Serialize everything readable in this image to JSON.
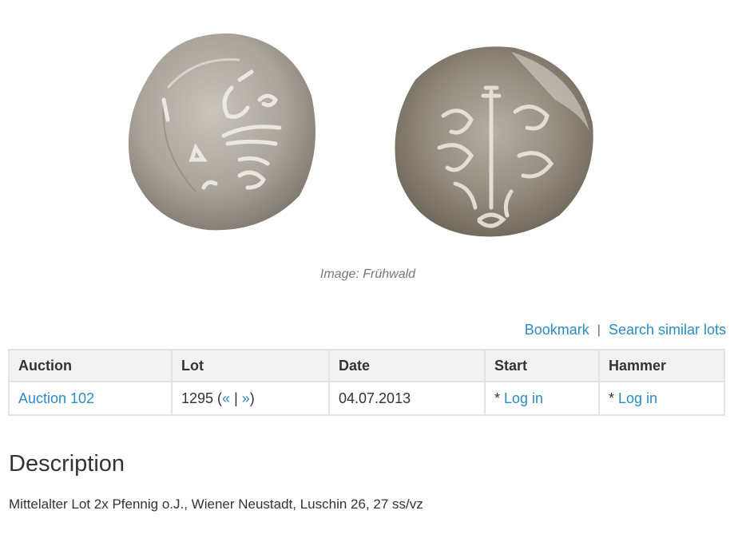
{
  "image": {
    "caption": "Image: Frühwald"
  },
  "actions": {
    "bookmark": "Bookmark",
    "separator": "|",
    "search_similar": "Search similar lots"
  },
  "table": {
    "headers": [
      "Auction",
      "Lot",
      "Date",
      "Start",
      "Hammer"
    ],
    "row": {
      "auction": "Auction 102",
      "lot_number": "1295",
      "lot_open": " (",
      "prev": "«",
      "nav_sep": " | ",
      "next": "»",
      "lot_close": ")",
      "date": "04.07.2013",
      "start_prefix": "* ",
      "start_link": "Log in",
      "hammer_prefix": "* ",
      "hammer_link": "Log in"
    }
  },
  "description": {
    "title": "Description",
    "text": "Mittelalter Lot 2x Pfennig o.J., Wiener Neustadt, Luschin 26, 27 ss/vz"
  },
  "colors": {
    "link": "#2a8bc7",
    "header_bg": "#f2f2f2",
    "border": "#e3e3e3"
  }
}
